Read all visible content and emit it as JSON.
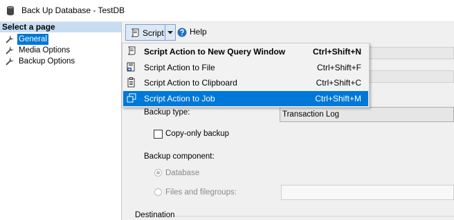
{
  "window": {
    "title": "Back Up Database - TestDB"
  },
  "sidebar": {
    "header": "Select a page",
    "items": [
      {
        "label": "General",
        "selected": true
      },
      {
        "label": "Media Options",
        "selected": false
      },
      {
        "label": "Backup Options",
        "selected": false
      }
    ]
  },
  "toolbar": {
    "script_label": "Script",
    "help_label": "Help"
  },
  "script_menu": {
    "items": [
      {
        "label": "Script Action to New Query Window",
        "shortcut": "Ctrl+Shift+N",
        "icon": "new-query-icon",
        "default": true,
        "highlighted": false
      },
      {
        "label": "Script Action to File",
        "shortcut": "Ctrl+Shift+F",
        "icon": "save-file-icon",
        "default": false,
        "highlighted": false
      },
      {
        "label": "Script Action to Clipboard",
        "shortcut": "Ctrl+Shift+C",
        "icon": "clipboard-icon",
        "default": false,
        "highlighted": false
      },
      {
        "label": "Script Action to Job",
        "shortcut": "Ctrl+Shift+M",
        "icon": "job-icon",
        "default": false,
        "highlighted": true
      }
    ]
  },
  "form": {
    "backup_type_label": "Backup type:",
    "backup_type_value": "Transaction Log",
    "copy_only_label": "Copy-only backup",
    "copy_only_checked": false,
    "backup_component_label": "Backup component:",
    "component_options": [
      {
        "label": "Database",
        "checked": true,
        "enabled": false
      },
      {
        "label": "Files and filegroups:",
        "checked": false,
        "enabled": false
      }
    ],
    "destination_label": "Destination"
  },
  "colors": {
    "selection": "#0078d7",
    "sidebar_header": "#c8ddf2",
    "background": "#f0f0f0"
  }
}
